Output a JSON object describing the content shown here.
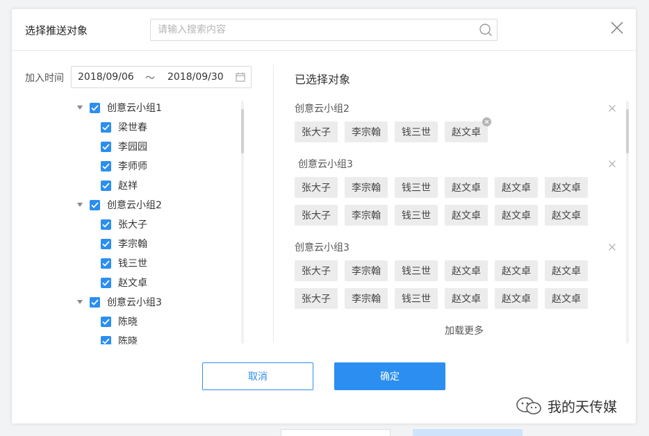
{
  "background": {
    "ghost_top_left": "",
    "ghost_top_right": ""
  },
  "dialog": {
    "title": "选择推送对象",
    "search_placeholder": "请输入搜索内容"
  },
  "filter": {
    "date_label": "加入时间",
    "date_start": "2018/09/06",
    "date_separator": "～",
    "date_end": "2018/09/30"
  },
  "tree": {
    "groups": [
      {
        "label": "创意云小组1",
        "members": [
          "梁世春",
          "李园园",
          "李师师",
          "赵祥"
        ]
      },
      {
        "label": "创意云小组2",
        "members": [
          "张大子",
          "李宗翰",
          "钱三世",
          "赵文卓"
        ]
      },
      {
        "label": "创意云小组3",
        "members": [
          "陈晓",
          "陈晓"
        ]
      }
    ]
  },
  "selected": {
    "title": "已选择对象",
    "groups": [
      {
        "label": "创意云小组2",
        "rows": [
          [
            "张大子",
            "李宗翰",
            "钱三世",
            "赵文卓"
          ]
        ]
      },
      {
        "label": "创意云小组3",
        "rows": [
          [
            "张大子",
            "李宗翰",
            "钱三世",
            "赵文卓",
            "赵文卓",
            "赵文卓"
          ],
          [
            "张大子",
            "李宗翰",
            "钱三世",
            "赵文卓",
            "赵文卓",
            "赵文卓"
          ]
        ]
      },
      {
        "label": "创意云小组3",
        "rows": [
          [
            "张大子",
            "李宗翰",
            "钱三世",
            "赵文卓",
            "赵文卓",
            "赵文卓"
          ],
          [
            "张大子",
            "李宗翰",
            "钱三世",
            "赵文卓",
            "赵文卓",
            "赵文卓"
          ]
        ]
      }
    ],
    "load_more": "加载更多"
  },
  "buttons": {
    "cancel": "取消",
    "confirm": "确定"
  },
  "watermark": "我的天传媒",
  "colors": {
    "accent": "#2b8ef0",
    "tag_bg": "#ececec"
  }
}
